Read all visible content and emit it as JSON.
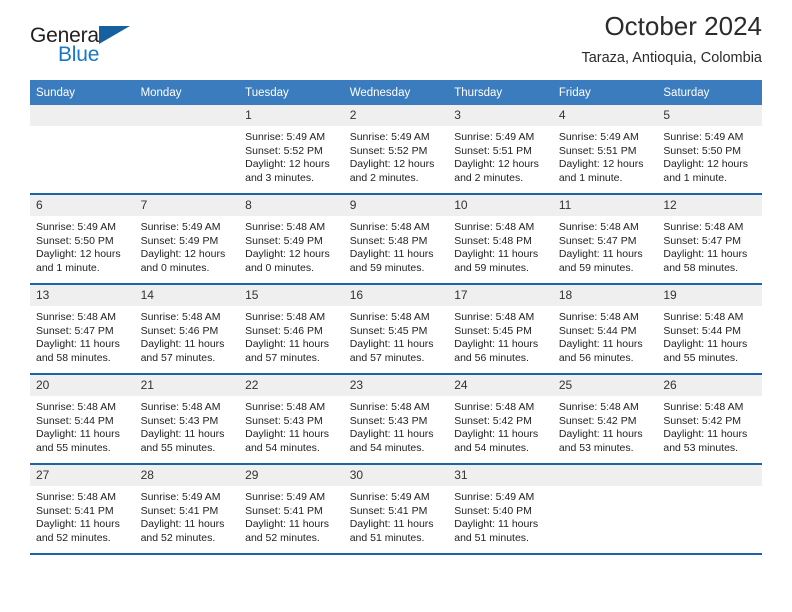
{
  "logo": {
    "word1": "General",
    "word2": "Blue",
    "triangle": "triangle-icon"
  },
  "header": {
    "month_title": "October 2024",
    "location": "Taraza, Antioquia, Colombia"
  },
  "colors": {
    "header_blue": "#3a7cbe",
    "rule_blue": "#1b64a8",
    "daynum_bg": "#efefef",
    "logo_blue": "#1878c8"
  },
  "weekdays": [
    "Sunday",
    "Monday",
    "Tuesday",
    "Wednesday",
    "Thursday",
    "Friday",
    "Saturday"
  ],
  "weeks": [
    [
      {
        "day": "",
        "empty": true,
        "sunrise": "",
        "sunset": "",
        "daylight1": "",
        "daylight2": ""
      },
      {
        "day": "",
        "empty": true,
        "sunrise": "",
        "sunset": "",
        "daylight1": "",
        "daylight2": ""
      },
      {
        "day": "1",
        "sunrise": "Sunrise: 5:49 AM",
        "sunset": "Sunset: 5:52 PM",
        "daylight1": "Daylight: 12 hours",
        "daylight2": "and 3 minutes."
      },
      {
        "day": "2",
        "sunrise": "Sunrise: 5:49 AM",
        "sunset": "Sunset: 5:52 PM",
        "daylight1": "Daylight: 12 hours",
        "daylight2": "and 2 minutes."
      },
      {
        "day": "3",
        "sunrise": "Sunrise: 5:49 AM",
        "sunset": "Sunset: 5:51 PM",
        "daylight1": "Daylight: 12 hours",
        "daylight2": "and 2 minutes."
      },
      {
        "day": "4",
        "sunrise": "Sunrise: 5:49 AM",
        "sunset": "Sunset: 5:51 PM",
        "daylight1": "Daylight: 12 hours",
        "daylight2": "and 1 minute."
      },
      {
        "day": "5",
        "sunrise": "Sunrise: 5:49 AM",
        "sunset": "Sunset: 5:50 PM",
        "daylight1": "Daylight: 12 hours",
        "daylight2": "and 1 minute."
      }
    ],
    [
      {
        "day": "6",
        "sunrise": "Sunrise: 5:49 AM",
        "sunset": "Sunset: 5:50 PM",
        "daylight1": "Daylight: 12 hours",
        "daylight2": "and 1 minute."
      },
      {
        "day": "7",
        "sunrise": "Sunrise: 5:49 AM",
        "sunset": "Sunset: 5:49 PM",
        "daylight1": "Daylight: 12 hours",
        "daylight2": "and 0 minutes."
      },
      {
        "day": "8",
        "sunrise": "Sunrise: 5:48 AM",
        "sunset": "Sunset: 5:49 PM",
        "daylight1": "Daylight: 12 hours",
        "daylight2": "and 0 minutes."
      },
      {
        "day": "9",
        "sunrise": "Sunrise: 5:48 AM",
        "sunset": "Sunset: 5:48 PM",
        "daylight1": "Daylight: 11 hours",
        "daylight2": "and 59 minutes."
      },
      {
        "day": "10",
        "sunrise": "Sunrise: 5:48 AM",
        "sunset": "Sunset: 5:48 PM",
        "daylight1": "Daylight: 11 hours",
        "daylight2": "and 59 minutes."
      },
      {
        "day": "11",
        "sunrise": "Sunrise: 5:48 AM",
        "sunset": "Sunset: 5:47 PM",
        "daylight1": "Daylight: 11 hours",
        "daylight2": "and 59 minutes."
      },
      {
        "day": "12",
        "sunrise": "Sunrise: 5:48 AM",
        "sunset": "Sunset: 5:47 PM",
        "daylight1": "Daylight: 11 hours",
        "daylight2": "and 58 minutes."
      }
    ],
    [
      {
        "day": "13",
        "sunrise": "Sunrise: 5:48 AM",
        "sunset": "Sunset: 5:47 PM",
        "daylight1": "Daylight: 11 hours",
        "daylight2": "and 58 minutes."
      },
      {
        "day": "14",
        "sunrise": "Sunrise: 5:48 AM",
        "sunset": "Sunset: 5:46 PM",
        "daylight1": "Daylight: 11 hours",
        "daylight2": "and 57 minutes."
      },
      {
        "day": "15",
        "sunrise": "Sunrise: 5:48 AM",
        "sunset": "Sunset: 5:46 PM",
        "daylight1": "Daylight: 11 hours",
        "daylight2": "and 57 minutes."
      },
      {
        "day": "16",
        "sunrise": "Sunrise: 5:48 AM",
        "sunset": "Sunset: 5:45 PM",
        "daylight1": "Daylight: 11 hours",
        "daylight2": "and 57 minutes."
      },
      {
        "day": "17",
        "sunrise": "Sunrise: 5:48 AM",
        "sunset": "Sunset: 5:45 PM",
        "daylight1": "Daylight: 11 hours",
        "daylight2": "and 56 minutes."
      },
      {
        "day": "18",
        "sunrise": "Sunrise: 5:48 AM",
        "sunset": "Sunset: 5:44 PM",
        "daylight1": "Daylight: 11 hours",
        "daylight2": "and 56 minutes."
      },
      {
        "day": "19",
        "sunrise": "Sunrise: 5:48 AM",
        "sunset": "Sunset: 5:44 PM",
        "daylight1": "Daylight: 11 hours",
        "daylight2": "and 55 minutes."
      }
    ],
    [
      {
        "day": "20",
        "sunrise": "Sunrise: 5:48 AM",
        "sunset": "Sunset: 5:44 PM",
        "daylight1": "Daylight: 11 hours",
        "daylight2": "and 55 minutes."
      },
      {
        "day": "21",
        "sunrise": "Sunrise: 5:48 AM",
        "sunset": "Sunset: 5:43 PM",
        "daylight1": "Daylight: 11 hours",
        "daylight2": "and 55 minutes."
      },
      {
        "day": "22",
        "sunrise": "Sunrise: 5:48 AM",
        "sunset": "Sunset: 5:43 PM",
        "daylight1": "Daylight: 11 hours",
        "daylight2": "and 54 minutes."
      },
      {
        "day": "23",
        "sunrise": "Sunrise: 5:48 AM",
        "sunset": "Sunset: 5:43 PM",
        "daylight1": "Daylight: 11 hours",
        "daylight2": "and 54 minutes."
      },
      {
        "day": "24",
        "sunrise": "Sunrise: 5:48 AM",
        "sunset": "Sunset: 5:42 PM",
        "daylight1": "Daylight: 11 hours",
        "daylight2": "and 54 minutes."
      },
      {
        "day": "25",
        "sunrise": "Sunrise: 5:48 AM",
        "sunset": "Sunset: 5:42 PM",
        "daylight1": "Daylight: 11 hours",
        "daylight2": "and 53 minutes."
      },
      {
        "day": "26",
        "sunrise": "Sunrise: 5:48 AM",
        "sunset": "Sunset: 5:42 PM",
        "daylight1": "Daylight: 11 hours",
        "daylight2": "and 53 minutes."
      }
    ],
    [
      {
        "day": "27",
        "sunrise": "Sunrise: 5:48 AM",
        "sunset": "Sunset: 5:41 PM",
        "daylight1": "Daylight: 11 hours",
        "daylight2": "and 52 minutes."
      },
      {
        "day": "28",
        "sunrise": "Sunrise: 5:49 AM",
        "sunset": "Sunset: 5:41 PM",
        "daylight1": "Daylight: 11 hours",
        "daylight2": "and 52 minutes."
      },
      {
        "day": "29",
        "sunrise": "Sunrise: 5:49 AM",
        "sunset": "Sunset: 5:41 PM",
        "daylight1": "Daylight: 11 hours",
        "daylight2": "and 52 minutes."
      },
      {
        "day": "30",
        "sunrise": "Sunrise: 5:49 AM",
        "sunset": "Sunset: 5:41 PM",
        "daylight1": "Daylight: 11 hours",
        "daylight2": "and 51 minutes."
      },
      {
        "day": "31",
        "sunrise": "Sunrise: 5:49 AM",
        "sunset": "Sunset: 5:40 PM",
        "daylight1": "Daylight: 11 hours",
        "daylight2": "and 51 minutes."
      },
      {
        "day": "",
        "empty": true,
        "sunrise": "",
        "sunset": "",
        "daylight1": "",
        "daylight2": ""
      },
      {
        "day": "",
        "empty": true,
        "sunrise": "",
        "sunset": "",
        "daylight1": "",
        "daylight2": ""
      }
    ]
  ]
}
